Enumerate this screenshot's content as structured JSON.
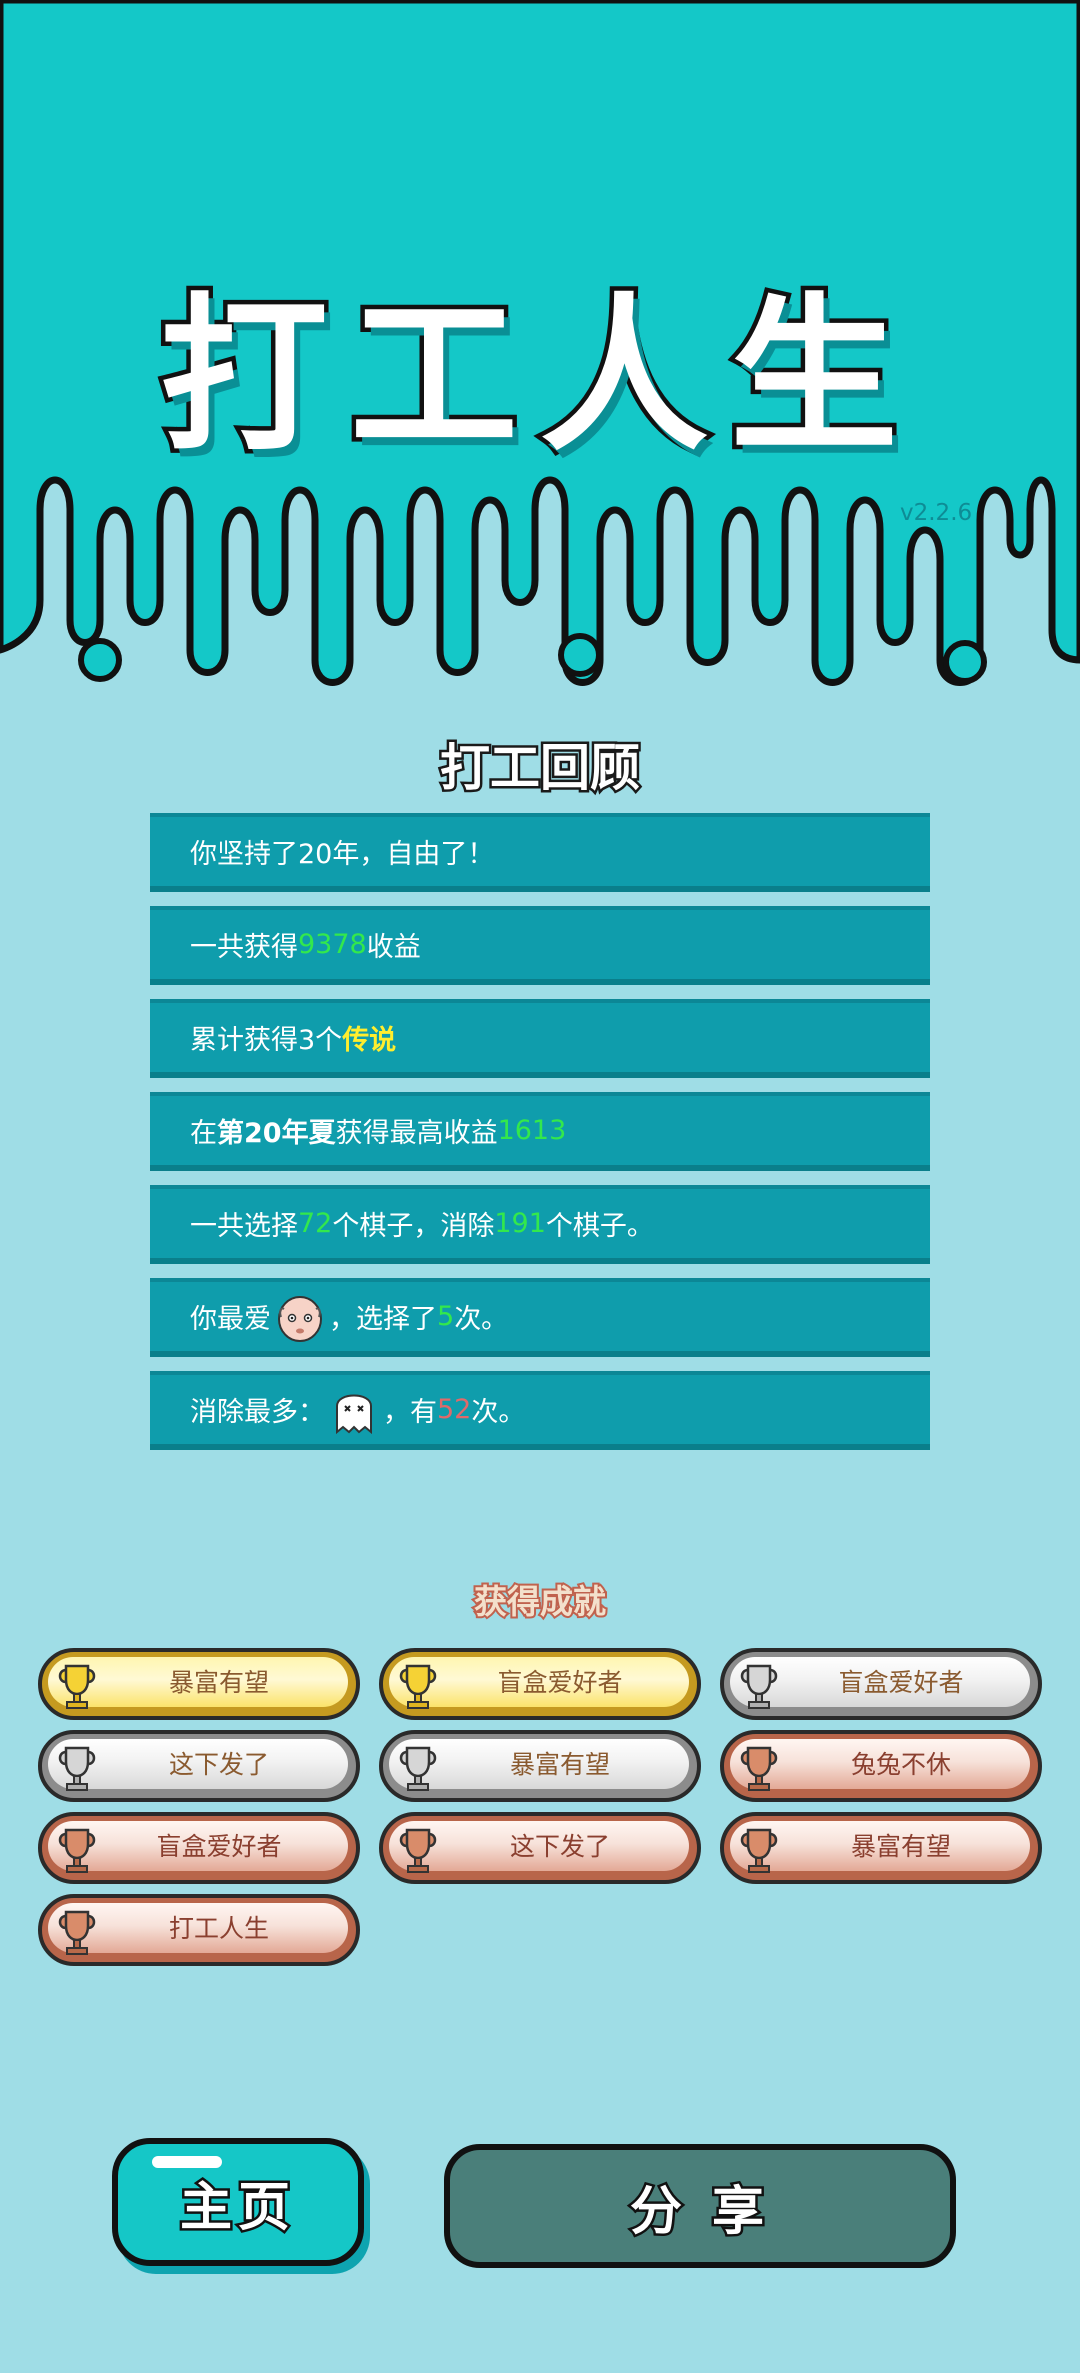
{
  "app": {
    "title": "打工人生",
    "version": "v2.2.6"
  },
  "review": {
    "title": "打工回顾",
    "rows": [
      {
        "parts": [
          "你坚持了20年，自由了！"
        ]
      },
      {
        "pre": "一共获得",
        "value": "9378",
        "post": "收益"
      },
      {
        "pre": "累计获得3个",
        "value": "传说"
      },
      {
        "pre": "在 ",
        "bold": "第20年夏",
        "mid": " 获得最高收益",
        "value": "1613"
      },
      {
        "pre": "一共选择",
        "value1": "72",
        "mid": "个棋子，消除",
        "value2": "191",
        "post": "个棋子。"
      },
      {
        "pre": "你最爱",
        "icon": "bald-face-icon",
        "mid": "，选择了",
        "value": "5",
        "post": "次。"
      },
      {
        "pre": "消除最多：",
        "icon": "ghost-icon",
        "mid": "，有",
        "value": "52",
        "post": "次。"
      }
    ]
  },
  "achievements": {
    "title": "获得成就",
    "badges": [
      {
        "label": "暴富有望",
        "tier": "gold",
        "icon": "trophy-icon"
      },
      {
        "label": "盲盒爱好者",
        "tier": "gold",
        "icon": "trophy-icon"
      },
      {
        "label": "盲盒爱好者",
        "tier": "silver",
        "icon": "trophy-icon"
      },
      {
        "label": "这下发了",
        "tier": "silver",
        "icon": "trophy-icon"
      },
      {
        "label": "暴富有望",
        "tier": "silver",
        "icon": "trophy-icon"
      },
      {
        "label": "兔兔不休",
        "tier": "bronze",
        "icon": "trophy-icon"
      },
      {
        "label": "盲盒爱好者",
        "tier": "bronze",
        "icon": "trophy-icon"
      },
      {
        "label": "这下发了",
        "tier": "bronze",
        "icon": "trophy-icon"
      },
      {
        "label": "暴富有望",
        "tier": "bronze",
        "icon": "trophy-icon"
      },
      {
        "label": "打工人生",
        "tier": "bronze",
        "icon": "trophy-icon"
      }
    ]
  },
  "buttons": {
    "home": "主页",
    "share": "分 享"
  },
  "colors": {
    "header": "#14c8c8",
    "page": "#9fdde6",
    "row": "#0f9dac",
    "green": "#33e84c",
    "yellow": "#ffee2e",
    "red": "#e06a6a",
    "home_button": "#15c7c7",
    "share_button": "#4a7f7a"
  }
}
